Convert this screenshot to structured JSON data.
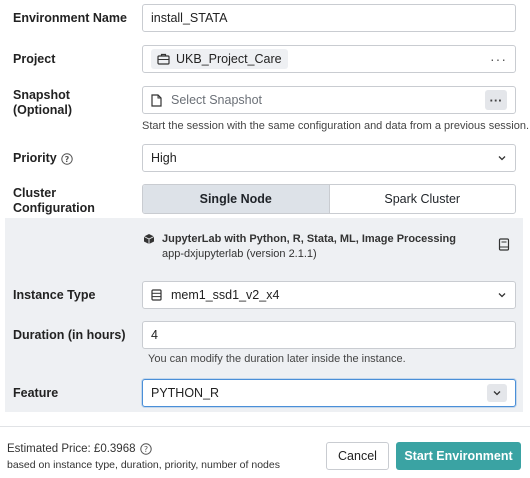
{
  "form": {
    "environment_name": {
      "label": "Environment Name",
      "value": "install_STATA"
    },
    "project": {
      "label": "Project",
      "value": "UKB_Project_Care",
      "more": "···"
    },
    "snapshot": {
      "label_line1": "Snapshot",
      "label_line2": "(Optional)",
      "placeholder": "Select Snapshot",
      "more": "···",
      "help": "Start the session with the same configuration and data from a previous session."
    },
    "priority": {
      "label": "Priority",
      "value": "High"
    },
    "cluster": {
      "label_line1": "Cluster",
      "label_line2": "Configuration",
      "options": [
        "Single Node",
        "Spark Cluster"
      ],
      "selected": "Single Node"
    },
    "app": {
      "title": "JupyterLab with Python, R, Stata, ML, Image Processing",
      "subtitle": "app-dxjupyterlab (version 2.1.1)"
    },
    "instance_type": {
      "label": "Instance Type",
      "value": "mem1_ssd1_v2_x4"
    },
    "duration": {
      "label": "Duration (in hours)",
      "value": "4",
      "help": "You can modify the duration later inside the instance."
    },
    "feature": {
      "label": "Feature",
      "value": "PYTHON_R"
    }
  },
  "footer": {
    "price": "Estimated Price: £0.3968",
    "price_note": "based on instance type, duration, priority, number of nodes",
    "cancel": "Cancel",
    "start": "Start Environment"
  },
  "colors": {
    "accent": "#3aa3a3",
    "panel": "#eef0f3",
    "feature_border": "#4a8fd8"
  }
}
